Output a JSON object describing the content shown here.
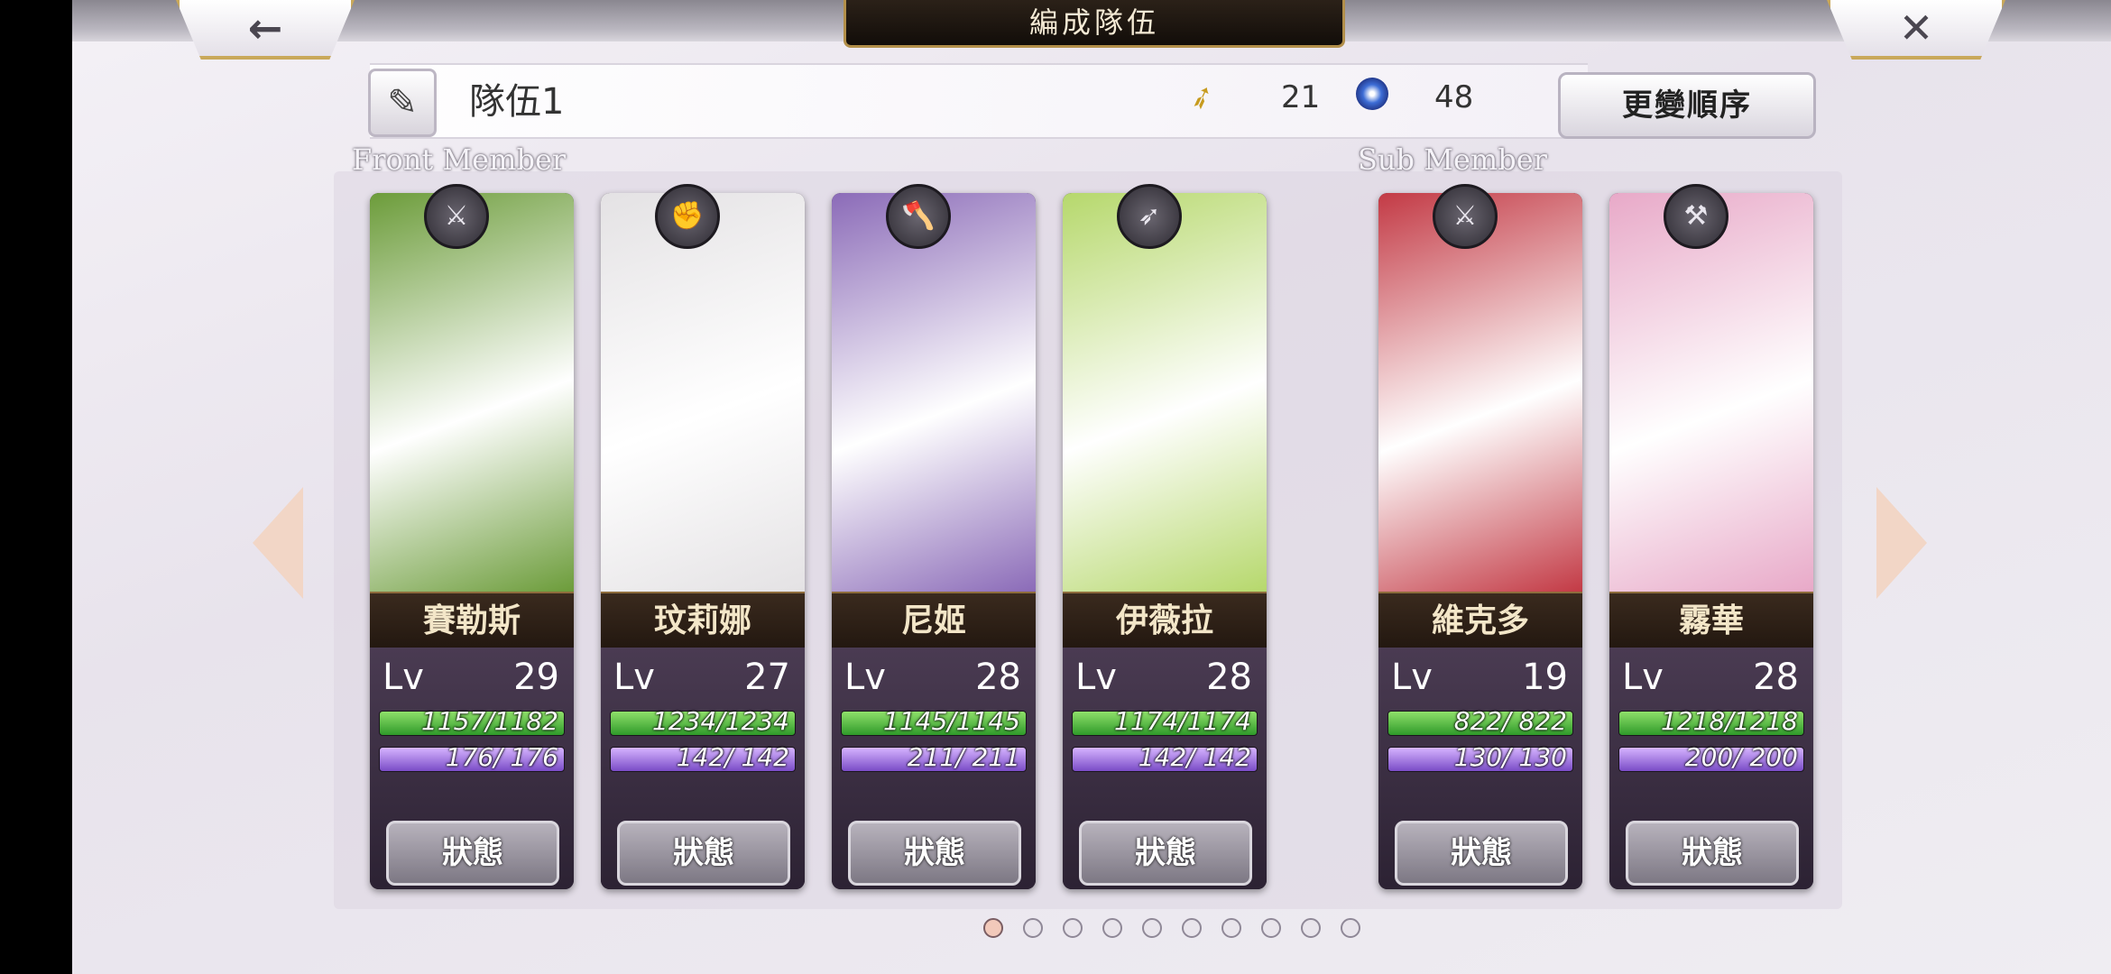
{
  "header": {
    "title": "編成隊伍",
    "back_icon": "←",
    "close_icon": "✕"
  },
  "team": {
    "name": "隊伍1",
    "edit_icon": "✎",
    "wings_value": "21",
    "orbs_value": "48",
    "order_button": "更變順序"
  },
  "sections": {
    "front_label": "Front Member",
    "sub_label": "Sub Member"
  },
  "members": [
    {
      "name": "賽勒斯",
      "lv_label": "Lv",
      "level": "29",
      "hp": "1157/1182",
      "hp_ratio": 0.98,
      "mp": "176/ 176",
      "status": "狀態",
      "weapon_icon": "sword-icon",
      "weapon_glyph": "⚔",
      "art_color": "#6c9c3a"
    },
    {
      "name": "玟莉娜",
      "lv_label": "Lv",
      "level": "27",
      "hp": "1234/1234",
      "hp_ratio": 1.0,
      "mp": "142/ 142",
      "status": "狀態",
      "weapon_icon": "fist-icon",
      "weapon_glyph": "✊",
      "art_color": "#e4e2e4"
    },
    {
      "name": "尼姬",
      "lv_label": "Lv",
      "level": "28",
      "hp": "1145/1145",
      "hp_ratio": 1.0,
      "mp": "211/ 211",
      "status": "狀態",
      "weapon_icon": "axe-icon",
      "weapon_glyph": "🪓",
      "art_color": "#8b6bb8"
    },
    {
      "name": "伊薇拉",
      "lv_label": "Lv",
      "level": "28",
      "hp": "1174/1174",
      "hp_ratio": 1.0,
      "mp": "142/ 142",
      "status": "狀態",
      "weapon_icon": "spear-icon",
      "weapon_glyph": "➶",
      "art_color": "#b6d86c"
    },
    {
      "name": "維克多",
      "lv_label": "Lv",
      "level": "19",
      "hp": "822/ 822",
      "hp_ratio": 1.0,
      "mp": "130/ 130",
      "status": "狀態",
      "weapon_icon": "sword-icon",
      "weapon_glyph": "⚔",
      "art_color": "#c33a45"
    },
    {
      "name": "霧華",
      "lv_label": "Lv",
      "level": "28",
      "hp": "1218/1218",
      "hp_ratio": 1.0,
      "mp": "200/ 200",
      "status": "狀態",
      "weapon_icon": "hammer-icon",
      "weapon_glyph": "⚒",
      "art_color": "#e8a9c8"
    }
  ],
  "pagination": {
    "total": 10,
    "active": 0
  }
}
